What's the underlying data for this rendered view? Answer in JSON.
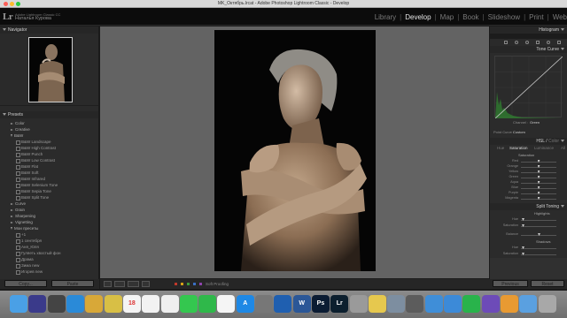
{
  "window": {
    "title": "MK_Октябрь.lrcat - Adobe Photoshop Lightroom Classic - Develop",
    "traffic_colors": [
      "#fc5f57",
      "#fdbc2e",
      "#28c840"
    ]
  },
  "identity_plate": {
    "logo": "Lr",
    "product": "Adobe Lightroom Classic CC",
    "user": "Наталья Курова"
  },
  "modules": [
    {
      "label": "Library",
      "active": false
    },
    {
      "label": "Develop",
      "active": true
    },
    {
      "label": "Map",
      "active": false
    },
    {
      "label": "Book",
      "active": false
    },
    {
      "label": "Slideshow",
      "active": false
    },
    {
      "label": "Print",
      "active": false
    },
    {
      "label": "Web",
      "active": false
    }
  ],
  "left_panel": {
    "navigator": {
      "title": "Navigator",
      "zoom": "FIT  FILL  1:1  3:1"
    },
    "presets": {
      "title": "Presets",
      "folders_top": [
        "Color",
        "Creative"
      ],
      "bw_folder": "B&W",
      "bw_items": [
        "B&W Landscape",
        "B&W High Contrast",
        "B&W Punch",
        "B&W Low Contrast",
        "B&W Flat",
        "B&W Soft",
        "B&W Infrared",
        "B&W Selenium Tone",
        "B&W Sepia Tone",
        "B&W Split Tone"
      ],
      "folders_mid": [
        "Curve",
        "Grain",
        "Sharpening",
        "Vignetting"
      ],
      "user_folder": "Мои пресеты",
      "user_items": [
        "+1",
        "1 сентября",
        "Аня_Юля",
        "Гуляеть хвостый фон",
        "Драма",
        "Зима new",
        "Игорев new"
      ]
    },
    "copy_label": "Copy...",
    "paste_label": "Paste"
  },
  "toolbar": {
    "soft_proofing_label": "Soft Proofing",
    "flag_colors": [
      "#c0392b",
      "#d4a017",
      "#3c9a3c",
      "#3b6fc4",
      "#8e44ad"
    ]
  },
  "right_panel": {
    "histogram_title": "Histogram",
    "tone_curve_title": "Tone Curve",
    "channel_label": "Channel :",
    "channel_value": "Green",
    "point_curve_label": "Point Curve :",
    "point_curve_value": "Custom",
    "hsl_title": "HSL",
    "hsl_color_title": "Color",
    "hsl_tabs": [
      "Hue",
      "Saturation",
      "Luminance",
      "All"
    ],
    "saturation_header": "Saturation",
    "saturation_sliders": [
      {
        "label": "Red",
        "value": 0.5
      },
      {
        "label": "Orange",
        "value": 0.5
      },
      {
        "label": "Yellow",
        "value": 0.5
      },
      {
        "label": "Green",
        "value": 0.5
      },
      {
        "label": "Aqua",
        "value": 0.5
      },
      {
        "label": "Blue",
        "value": 0.5
      },
      {
        "label": "Purple",
        "value": 0.5
      },
      {
        "label": "Magenta",
        "value": 0.5
      }
    ],
    "split_toning_title": "Split Toning",
    "highlights_label": "Highlights",
    "hue_label": "Hue",
    "saturation_label": "Saturation",
    "balance_label": "Balance",
    "shadows_label": "Shadows",
    "previous_label": "Previous",
    "reset_label": "Reset"
  },
  "dock": {
    "items": [
      {
        "name": "finder-icon",
        "color": "#4aa0e6",
        "glyph": ""
      },
      {
        "name": "siri-icon",
        "color": "#3a3a8a",
        "glyph": ""
      },
      {
        "name": "launchpad-icon",
        "color": "#444",
        "glyph": ""
      },
      {
        "name": "safari-icon",
        "color": "#2a8ad8",
        "glyph": ""
      },
      {
        "name": "stickies-icon",
        "color": "#d8a838",
        "glyph": ""
      },
      {
        "name": "notes-icon",
        "color": "#d8bf45",
        "glyph": ""
      },
      {
        "name": "calendar-icon",
        "color": "#f4f4f4",
        "glyph": "18"
      },
      {
        "name": "reminders-icon",
        "color": "#f2f2f2",
        "glyph": ""
      },
      {
        "name": "photos-icon",
        "color": "#efefef",
        "glyph": ""
      },
      {
        "name": "messages-icon",
        "color": "#34c74f",
        "glyph": ""
      },
      {
        "name": "facetime-icon",
        "color": "#2fb84a",
        "glyph": ""
      },
      {
        "name": "music-icon",
        "color": "#f5f5f5",
        "glyph": ""
      },
      {
        "name": "app-store-icon",
        "color": "#1e88e5",
        "glyph": "A"
      },
      {
        "name": "system-preferences-icon",
        "color": "#777",
        "glyph": ""
      },
      {
        "name": "textedit-icon",
        "color": "#1f5fb0",
        "glyph": ""
      },
      {
        "name": "word-icon",
        "color": "#2b5797",
        "glyph": "W"
      },
      {
        "name": "photoshop-icon",
        "color": "#0b1c33",
        "glyph": "Ps"
      },
      {
        "name": "lightroom-icon",
        "color": "#0c1f2e",
        "glyph": "Lr"
      },
      {
        "name": "script-editor-icon",
        "color": "#9a9a9a",
        "glyph": ""
      },
      {
        "name": "stickies-notes-icon",
        "color": "#e6c84e",
        "glyph": ""
      },
      {
        "name": "preview-icon",
        "color": "#7d8ea0",
        "glyph": ""
      },
      {
        "name": "image-capture-icon",
        "color": "#5c5c5c",
        "glyph": ""
      },
      {
        "name": "folder-icon",
        "color": "#3f8ed8",
        "glyph": ""
      },
      {
        "name": "keynote-icon",
        "color": "#3c8ad8",
        "glyph": ""
      },
      {
        "name": "whatsapp-icon",
        "color": "#29b34b",
        "glyph": ""
      },
      {
        "name": "viber-icon",
        "color": "#6d4bb8",
        "glyph": ""
      },
      {
        "name": "books-icon",
        "color": "#e89a32",
        "glyph": ""
      },
      {
        "name": "downloads-icon",
        "color": "#5aa0e0",
        "glyph": ""
      },
      {
        "name": "trash-icon",
        "color": "#a8a8a8",
        "glyph": ""
      }
    ]
  }
}
